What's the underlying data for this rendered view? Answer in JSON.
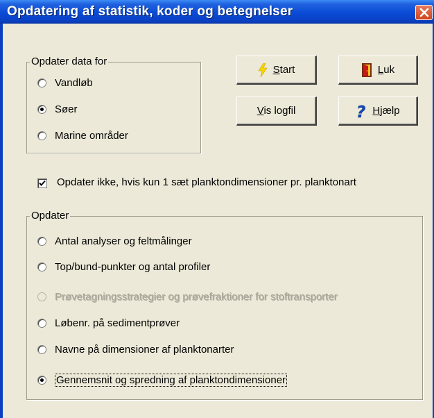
{
  "window": {
    "title": "Opdatering af statistik, koder og betegnelser"
  },
  "data_group": {
    "legend": "Opdater data for",
    "options": [
      {
        "label": "Vandløb",
        "checked": false
      },
      {
        "label": "Søer",
        "checked": true
      },
      {
        "label": "Marine områder",
        "checked": false
      }
    ]
  },
  "buttons": {
    "start_label_u": "S",
    "start_label_rest": "tart",
    "close_label_u": "L",
    "close_label_rest": "uk",
    "log_label_u": "V",
    "log_label_rest": "is logfil",
    "help_label_u": "H",
    "help_label_rest": "jælp"
  },
  "checkbox": {
    "label": "Opdater ikke, hvis kun 1 sæt planktondimensioner pr. planktonart",
    "checked": true
  },
  "update_group": {
    "legend": "Opdater",
    "options": [
      {
        "label": "Antal analyser og feltmålinger",
        "checked": false,
        "disabled": false
      },
      {
        "label": "Top/bund-punkter og antal profiler",
        "checked": false,
        "disabled": false
      },
      {
        "label": "Prøvetagningsstrategier og prøvefraktioner for stoftransporter",
        "checked": false,
        "disabled": true
      },
      {
        "label": "Løbenr. på sedimentprøver",
        "checked": false,
        "disabled": false
      },
      {
        "label": "Navne på dimensioner af planktonarter",
        "checked": false,
        "disabled": false
      },
      {
        "label": "Gennemsnit og spredning af planktondimensioner",
        "checked": true,
        "disabled": false
      }
    ]
  },
  "colors": {
    "titlebar": "#0A4BD6",
    "dialog_bg": "#ECE9D8",
    "close_btn": "#D0441C"
  },
  "icons": [
    "close-icon",
    "lightning-icon",
    "door-exit-icon",
    "question-icon"
  ]
}
